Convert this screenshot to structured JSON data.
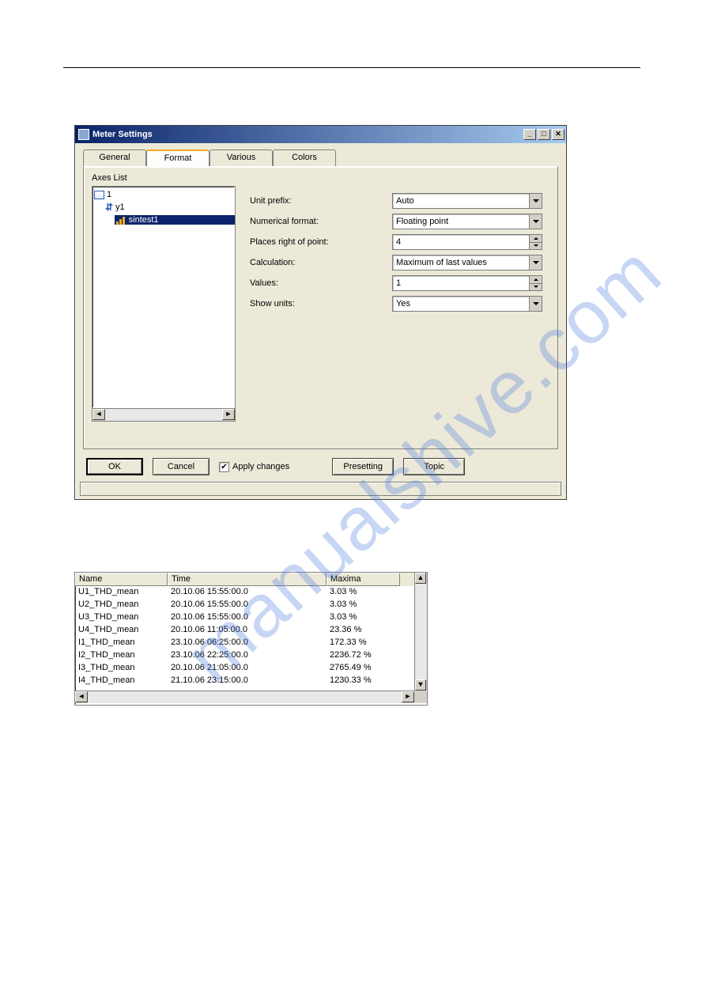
{
  "dialog": {
    "title": "Meter Settings",
    "tabs": [
      "General",
      "Format",
      "Various",
      "Colors"
    ],
    "active_tab": "Format",
    "axes_label": "Axes List",
    "tree": {
      "root": "1",
      "axis": "y1",
      "signal": "sintest1"
    },
    "fields": {
      "unit_prefix": {
        "label": "Unit prefix:",
        "value": "Auto"
      },
      "num_format": {
        "label": "Numerical format:",
        "value": "Floating point"
      },
      "places": {
        "label": "Places right of point:",
        "value": "4"
      },
      "calculation": {
        "label": "Calculation:",
        "value": "Maximum of last values"
      },
      "values": {
        "label": "Values:",
        "value": "1"
      },
      "show_units": {
        "label": "Show units:",
        "value": "Yes"
      }
    },
    "buttons": {
      "ok": "OK",
      "cancel": "Cancel",
      "apply_changes": "Apply changes",
      "presetting": "Presetting",
      "topic": "Topic"
    },
    "apply_checked": true
  },
  "listview": {
    "columns": [
      "Name",
      "Time",
      "Maxima"
    ],
    "rows": [
      {
        "name": "U1_THD_mean",
        "time": "20.10.06 15:55:00.0",
        "max": "3.03 %"
      },
      {
        "name": "U2_THD_mean",
        "time": "20.10.06 15:55:00.0",
        "max": "3.03 %"
      },
      {
        "name": "U3_THD_mean",
        "time": "20.10.06 15:55:00.0",
        "max": "3.03 %"
      },
      {
        "name": "U4_THD_mean",
        "time": "20.10.06 11:05:00.0",
        "max": "23.36 %"
      },
      {
        "name": "I1_THD_mean",
        "time": "23.10.06 06:25:00.0",
        "max": "172.33 %"
      },
      {
        "name": "I2_THD_mean",
        "time": "23.10.06 22:25:00.0",
        "max": "2236.72 %"
      },
      {
        "name": "I3_THD_mean",
        "time": "20.10.06 21:05:00.0",
        "max": "2765.49 %"
      },
      {
        "name": "I4_THD_mean",
        "time": "21.10.06 23:15:00.0",
        "max": "1230.33 %"
      }
    ]
  },
  "watermark": "manualshive.com"
}
